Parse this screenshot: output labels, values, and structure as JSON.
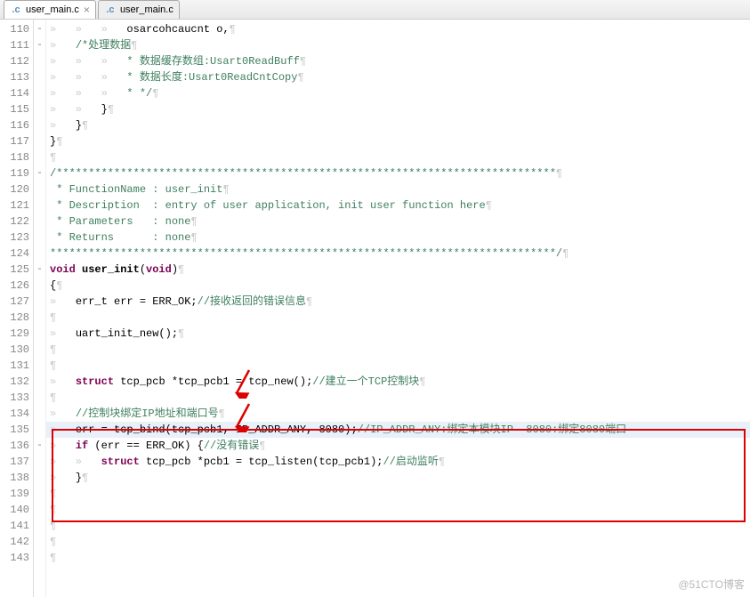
{
  "tabs": [
    {
      "filename": "user_main.c",
      "active": true
    },
    {
      "filename": "user_main.c",
      "active": false
    }
  ],
  "watermark": "@51CTO博客",
  "lines": [
    {
      "num": 110,
      "fold": "-",
      "html": "<span class='ws'>»   »   »   </span><span class='str'>osarcohcaucnt&nbsp;o,</span><span class='ws'>¶</span>"
    },
    {
      "num": 111,
      "fold": "-",
      "html": "<span class='ws'>»   </span><span class='cm'>/*处理数据</span><span class='ws'>¶</span>"
    },
    {
      "num": 112,
      "fold": "",
      "html": "<span class='ws'>»   »   »   </span><span class='cm'>* 数据缓存数组:Usart0ReadBuff</span><span class='ws'>¶</span>"
    },
    {
      "num": 113,
      "fold": "",
      "html": "<span class='ws'>»   »   »   </span><span class='cm'>* 数据长度:Usart0ReadCntCopy</span><span class='ws'>¶</span>"
    },
    {
      "num": 114,
      "fold": "",
      "html": "<span class='ws'>»   »   »   </span><span class='cm'>* */</span><span class='ws'>¶</span>"
    },
    {
      "num": 115,
      "fold": "",
      "html": "<span class='ws'>»   »   </span>}<span class='ws'>¶</span>"
    },
    {
      "num": 116,
      "fold": "",
      "html": "<span class='ws'>»   </span>}<span class='ws'>¶</span>"
    },
    {
      "num": 117,
      "fold": "",
      "html": "}<span class='ws'>¶</span>"
    },
    {
      "num": 118,
      "fold": "",
      "html": "<span class='ws'>¶</span>"
    },
    {
      "num": 119,
      "fold": "-",
      "html": "<span class='cm'>/******************************************************************************</span><span class='ws'>¶</span>"
    },
    {
      "num": 120,
      "fold": "",
      "html": "<span class='cm'>&nbsp;* FunctionName : user_init</span><span class='ws'>¶</span>"
    },
    {
      "num": 121,
      "fold": "",
      "html": "<span class='cm'>&nbsp;* Description  : entry of user application, init user function here</span><span class='ws'>¶</span>"
    },
    {
      "num": 122,
      "fold": "",
      "html": "<span class='cm'>&nbsp;* Parameters   : none</span><span class='ws'>¶</span>"
    },
    {
      "num": 123,
      "fold": "",
      "html": "<span class='cm'>&nbsp;* Returns      : none</span><span class='ws'>¶</span>"
    },
    {
      "num": 124,
      "fold": "",
      "html": "<span class='cm'>*******************************************************************************/</span><span class='ws'>¶</span>"
    },
    {
      "num": 125,
      "fold": "-",
      "html": "<span class='kw'>void</span> <b>user_init</b>(<span class='kw'>void</span>)<span class='ws'>¶</span>"
    },
    {
      "num": 126,
      "fold": "",
      "html": "{<span class='ws'>¶</span>"
    },
    {
      "num": 127,
      "fold": "",
      "html": "<span class='ws'>»   </span>err_t err = ERR_OK;<span class='cm2'>//接收返回的错误信息</span><span class='ws'>¶</span>"
    },
    {
      "num": 128,
      "fold": "",
      "html": "<span class='ws'>¶</span>"
    },
    {
      "num": 129,
      "fold": "",
      "html": "<span class='ws'>»   </span>uart_init_new();<span class='ws'>¶</span>"
    },
    {
      "num": 130,
      "fold": "",
      "html": "<span class='ws'>¶</span>"
    },
    {
      "num": 131,
      "fold": "",
      "html": "<span class='ws'>¶</span>"
    },
    {
      "num": 132,
      "fold": "",
      "html": "<span class='ws'>»   </span><span class='kw'>struct</span> tcp_pcb *tcp_pcb1 = tcp_new();<span class='cm2'>//建立一个TCP控制块</span><span class='ws'>¶</span>"
    },
    {
      "num": 133,
      "fold": "",
      "html": "<span class='ws'>¶</span>"
    },
    {
      "num": 134,
      "fold": "",
      "html": "<span class='ws'>»   </span><span class='cm2'>//控制块绑定IP地址和端口号</span><span class='ws'>¶</span>"
    },
    {
      "num": 135,
      "fold": "",
      "html": "<span class='ws'>»   </span>err = tcp_bind(tcp_pcb1, IP_ADDR_ANY, 8080);<span class='cm2'>//IP_ADDR_ANY:绑定本模块IP  8080:绑定8080端口</span>",
      "hl": true
    },
    {
      "num": 136,
      "fold": "-",
      "html": "<span class='ws'>»   </span><span class='kw'>if</span> (err == ERR_OK) {<span class='cm2'>//没有错误</span><span class='ws'>¶</span>"
    },
    {
      "num": 137,
      "fold": "",
      "html": "<span class='ws'>»   »   </span><span class='kw'>struct</span> tcp_pcb *pcb1 = tcp_listen(tcp_pcb1);<span class='cm2'>//启动监听</span><span class='ws'>¶</span>"
    },
    {
      "num": 138,
      "fold": "",
      "html": "<span class='ws'>»   </span>}<span class='ws'>¶</span>"
    },
    {
      "num": 139,
      "fold": "",
      "html": "<span class='ws'>¶</span>"
    },
    {
      "num": 140,
      "fold": "",
      "html": "<span class='ws'>¶</span>"
    },
    {
      "num": 141,
      "fold": "",
      "html": "<span class='ws'>¶</span>"
    },
    {
      "num": 142,
      "fold": "",
      "html": "<span class='ws'>¶</span>"
    },
    {
      "num": 143,
      "fold": "",
      "html": "<span class='ws'>¶</span>"
    }
  ]
}
